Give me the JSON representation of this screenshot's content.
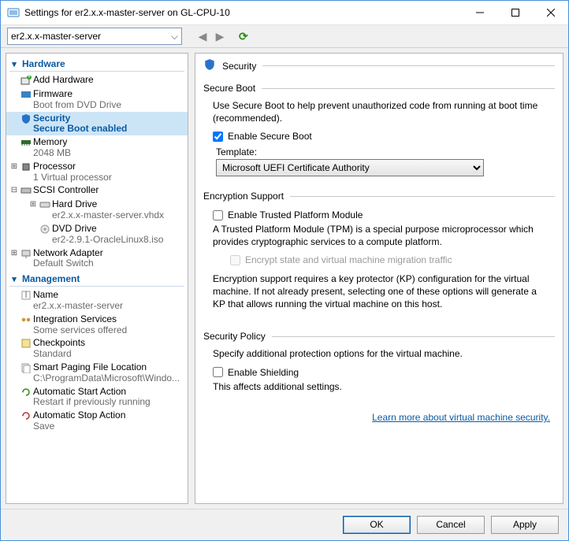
{
  "titlebar": {
    "title": "Settings for er2.x.x-master-server on GL-CPU-10"
  },
  "toolbar": {
    "vm_selector": "er2.x.x-master-server"
  },
  "nav": {
    "sections": {
      "hardware": "Hardware",
      "management": "Management"
    },
    "hardware": {
      "add_hardware": "Add Hardware",
      "firmware": {
        "label": "Firmware",
        "sub": "Boot from DVD Drive"
      },
      "security": {
        "label": "Security",
        "sub": "Secure Boot enabled"
      },
      "memory": {
        "label": "Memory",
        "sub": "2048 MB"
      },
      "processor": {
        "label": "Processor",
        "sub": "1 Virtual processor"
      },
      "scsi": {
        "label": "SCSI Controller"
      },
      "hard_drive": {
        "label": "Hard Drive",
        "sub": "er2.x.x-master-server.vhdx"
      },
      "dvd_drive": {
        "label": "DVD Drive",
        "sub": "er2-2.9.1-OracleLinux8.iso"
      },
      "network": {
        "label": "Network Adapter",
        "sub": "Default Switch"
      }
    },
    "management": {
      "name": {
        "label": "Name",
        "sub": "er2.x.x-master-server"
      },
      "integration": {
        "label": "Integration Services",
        "sub": "Some services offered"
      },
      "checkpoints": {
        "label": "Checkpoints",
        "sub": "Standard"
      },
      "smart_paging": {
        "label": "Smart Paging File Location",
        "sub": "C:\\ProgramData\\Microsoft\\Windo..."
      },
      "auto_start": {
        "label": "Automatic Start Action",
        "sub": "Restart if previously running"
      },
      "auto_stop": {
        "label": "Automatic Stop Action",
        "sub": "Save"
      }
    }
  },
  "panel": {
    "header": "Security",
    "secure_boot": {
      "title": "Secure Boot",
      "desc": "Use Secure Boot to help prevent unauthorized code from running at boot time (recommended).",
      "enable_label": "Enable Secure Boot",
      "enable_checked": true,
      "template_label": "Template:",
      "template_value": "Microsoft UEFI Certificate Authority"
    },
    "encryption": {
      "title": "Encryption Support",
      "enable_tpm_label": "Enable Trusted Platform Module",
      "enable_tpm_checked": false,
      "tpm_desc": "A Trusted Platform Module (TPM) is a special purpose microprocessor which provides cryptographic services to a compute platform.",
      "encrypt_traffic_label": "Encrypt state and virtual machine migration traffic",
      "encrypt_traffic_checked": false,
      "kp_note": "Encryption support requires a key protector (KP) configuration for the virtual machine. If not already present, selecting one of these options will generate a KP that allows running the virtual machine on this host."
    },
    "policy": {
      "title": "Security Policy",
      "desc": "Specify additional protection options for the virtual machine.",
      "shielding_label": "Enable Shielding",
      "shielding_checked": false,
      "shielding_note": "This affects additional settings."
    },
    "link": "Learn more about virtual machine security."
  },
  "footer": {
    "ok": "OK",
    "cancel": "Cancel",
    "apply": "Apply"
  }
}
